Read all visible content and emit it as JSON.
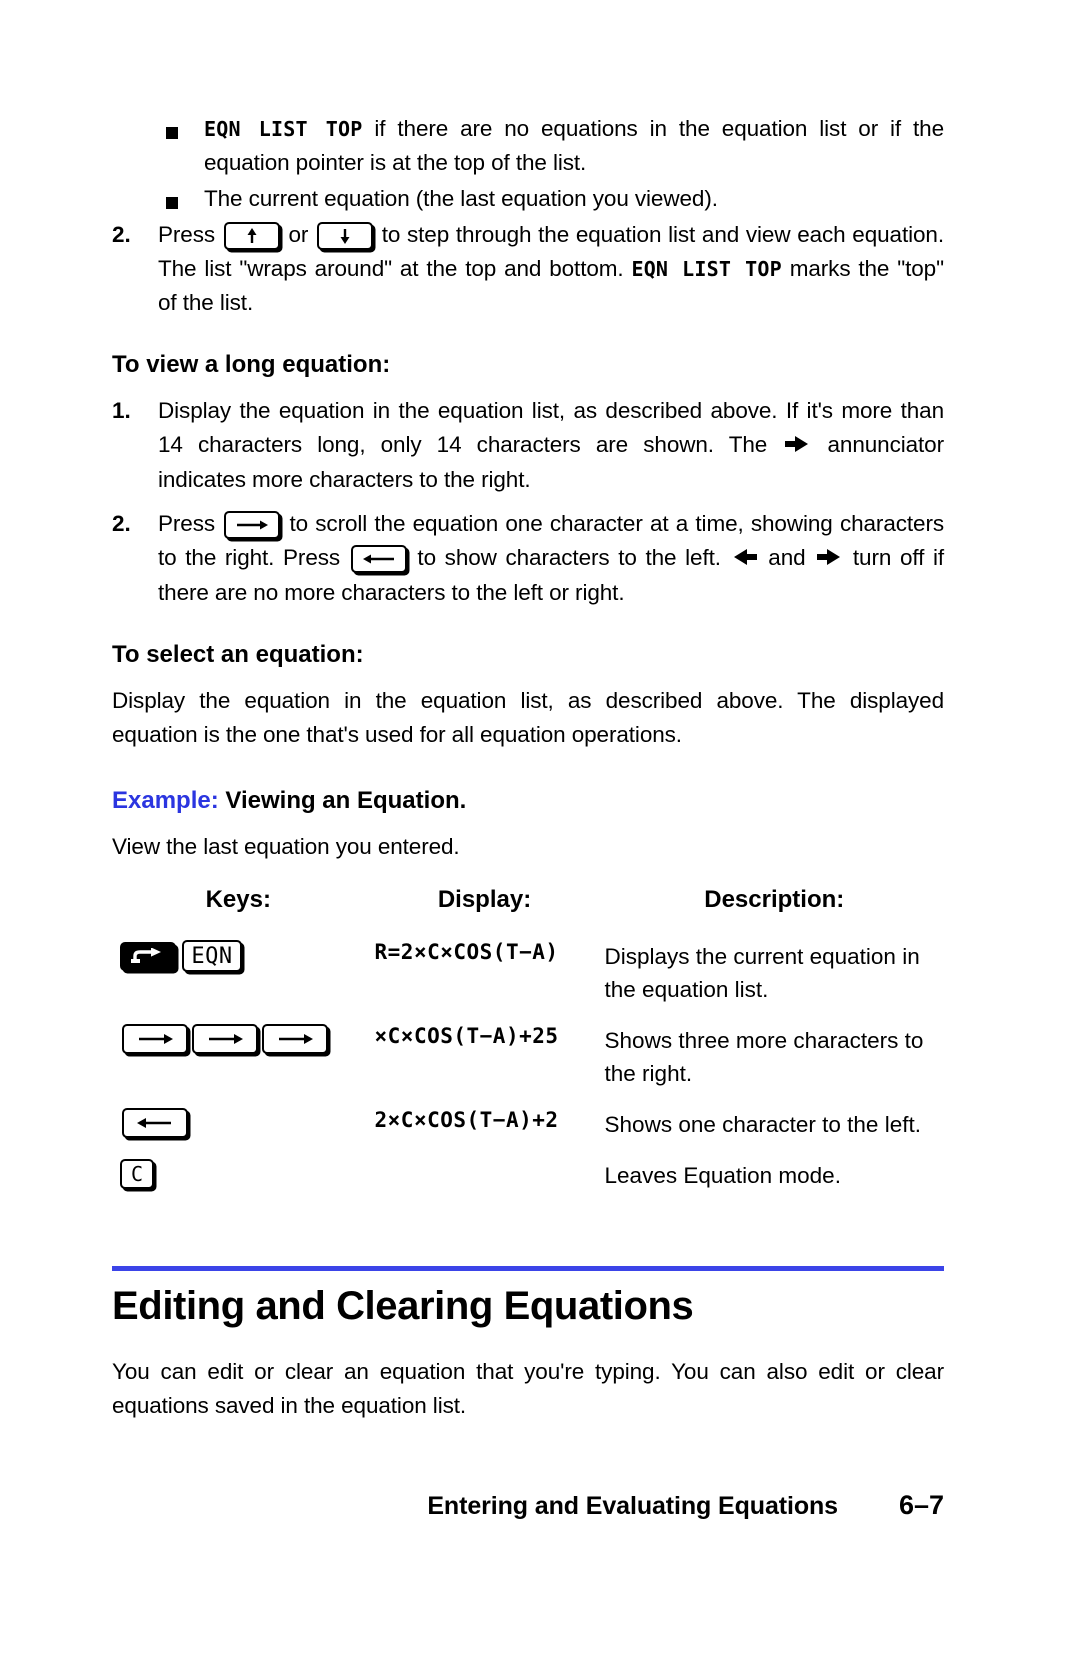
{
  "page": {
    "number": "6–7",
    "footer_title": "Entering and Evaluating Equations",
    "accent_color": "#3b44e8"
  },
  "top_list": {
    "bullets": [
      {
        "lcd": "EQN LIST TOP",
        "text": " if there are no equations in the equation list or if the equation pointer is at the top of the list."
      },
      {
        "lcd": "",
        "text": "The current equation (the last equation you viewed)."
      }
    ],
    "step2": {
      "number": "2.",
      "part1": "Press ",
      "part2": " or ",
      "part3": " to step through the equation list and view each equation. The list \"wraps around\" at the top and bottom. ",
      "lcd": "EQN LIST TOP",
      "part4": " marks the \"top\" of the list.",
      "key_up": "up-arrow-key",
      "key_down": "down-arrow-key"
    }
  },
  "view_long": {
    "heading": "To view a long equation:",
    "step1": {
      "number": "1.",
      "part1": "Display the equation in the equation list, as described above. If it's more than 14 characters long, only 14 characters are shown. The ",
      "part2": " annunciator indicates more characters to the right."
    },
    "step2": {
      "number": "2.",
      "part1": "Press ",
      "part2": " to scroll the equation one character at a time, showing characters to the right. Press ",
      "part3": " to show characters to the left. ",
      "part4": " and ",
      "part5": " turn off if there are no more characters to the left or right."
    }
  },
  "select_eq": {
    "heading": "To select an equation:",
    "body": "Display the equation in the equation list, as described above. The displayed equation is the one that's used for all equation operations."
  },
  "example": {
    "label": "Example:",
    "title": " Viewing an Equation.",
    "intro": "View the last equation you entered.",
    "columns": {
      "keys": "Keys:",
      "display": "Display:",
      "description": "Description:"
    },
    "rows": [
      {
        "keys": [
          "shift-key",
          "eqn-key"
        ],
        "eqn_label": "EQN",
        "display": "R=2×C×COS(T−A)",
        "description": "Displays the current equation in the equation list."
      },
      {
        "keys": [
          "right-arrow-key",
          "right-arrow-key",
          "right-arrow-key"
        ],
        "eqn_label": "",
        "display": "×C×COS(T−A)+25",
        "description": "Shows three more characters to the right."
      },
      {
        "keys": [
          "left-arrow-key"
        ],
        "eqn_label": "",
        "display": "2×C×COS(T−A)+2",
        "description": "Shows one character to the left."
      },
      {
        "keys": [
          "c-key"
        ],
        "eqn_label": "C",
        "display": "",
        "description": "Leaves Equation mode."
      }
    ]
  },
  "editing_section": {
    "heading": "Editing and Clearing Equations",
    "body": "You can edit or clear an equation that you're typing. You can also edit or clear equations saved in the equation list."
  }
}
